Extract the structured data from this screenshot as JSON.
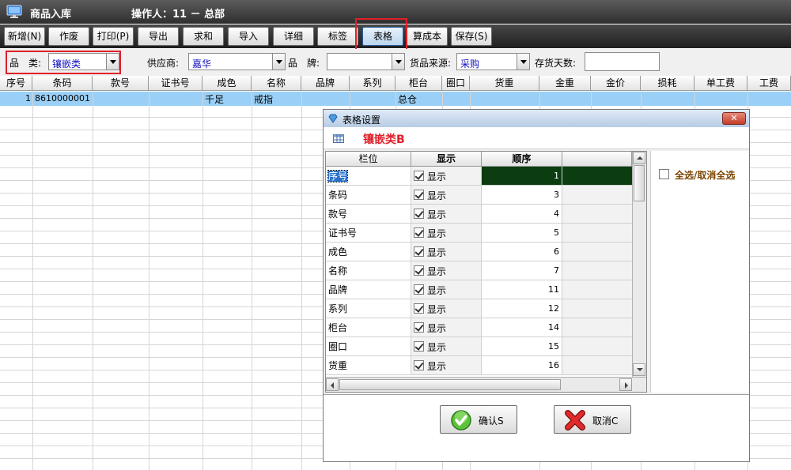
{
  "window": {
    "title": "商品入库",
    "operator": "操作人：11 － 总部"
  },
  "toolbar": [
    {
      "label": "新增(N)",
      "name": "new-button"
    },
    {
      "label": "作废",
      "name": "void-button"
    },
    {
      "label": "打印(P)",
      "name": "print-button"
    },
    {
      "label": "导出",
      "name": "export-button"
    },
    {
      "label": "求和",
      "name": "sum-button"
    },
    {
      "label": "导入",
      "name": "import-button"
    },
    {
      "label": "详细",
      "name": "detail-button"
    },
    {
      "label": "标签",
      "name": "label-button"
    },
    {
      "label": "表格",
      "name": "table-button"
    },
    {
      "label": "算成本",
      "name": "calc-cost-button"
    },
    {
      "label": "保存(S)",
      "name": "save-button"
    }
  ],
  "filters": {
    "category_label": "品　类:",
    "category_value": "镶嵌类",
    "supplier_label": "供应商:",
    "supplier_value": "嘉华",
    "brand_label": "品　牌:",
    "brand_value": "",
    "source_label": "货品来源:",
    "source_value": "采购",
    "stock_days_label": "存货天数:",
    "stock_days_value": ""
  },
  "grid": {
    "columns": [
      "序号",
      "条码",
      "款号",
      "证书号",
      "成色",
      "名称",
      "品牌",
      "系列",
      "柜台",
      "圈口",
      "货重",
      "金重",
      "金价",
      "损耗",
      "单工费",
      "工费"
    ],
    "rows": [
      [
        "1",
        "8610000001",
        "",
        "",
        "千足",
        "戒指",
        "",
        "",
        "总仓",
        "",
        "",
        "",
        "",
        "",
        "",
        ""
      ]
    ]
  },
  "dialog": {
    "title": "表格设置",
    "close_label": "✕",
    "grid_title": "镶嵌类B",
    "headers": [
      "栏位",
      "显示",
      "顺序"
    ],
    "rows": [
      {
        "field": "序号",
        "show": "显示",
        "order": "1"
      },
      {
        "field": "条码",
        "show": "显示",
        "order": "3"
      },
      {
        "field": "款号",
        "show": "显示",
        "order": "4"
      },
      {
        "field": "证书号",
        "show": "显示",
        "order": "5"
      },
      {
        "field": "成色",
        "show": "显示",
        "order": "6"
      },
      {
        "field": "名称",
        "show": "显示",
        "order": "7"
      },
      {
        "field": "品牌",
        "show": "显示",
        "order": "11"
      },
      {
        "field": "系列",
        "show": "显示",
        "order": "12"
      },
      {
        "field": "柜台",
        "show": "显示",
        "order": "14"
      },
      {
        "field": "圈口",
        "show": "显示",
        "order": "15"
      },
      {
        "field": "货重",
        "show": "显示",
        "order": "16"
      }
    ],
    "select_all_label": "全选/取消全选",
    "confirm_label": "确认S",
    "cancel_label": "取消C"
  },
  "colors": {
    "selection": "#9ad0f7",
    "highlight_red": "#e0202a",
    "order_cell_selected": "#0b3d10"
  }
}
